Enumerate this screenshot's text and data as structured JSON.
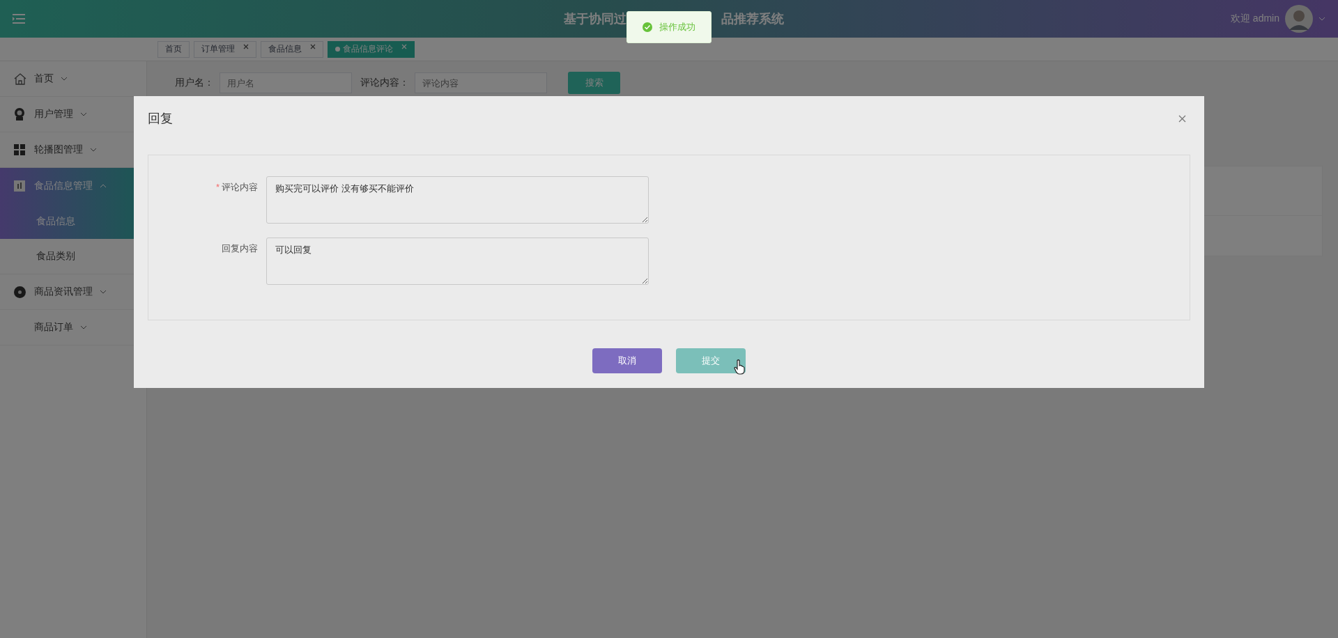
{
  "header": {
    "title_parts": [
      "基于协同过",
      "品推荐系统"
    ],
    "welcome": "欢迎 admin"
  },
  "toast": {
    "kind": "success",
    "message": "操作成功"
  },
  "tabs": [
    {
      "label": "首页",
      "selected": false,
      "closable": false
    },
    {
      "label": "订单管理",
      "selected": false,
      "closable": true
    },
    {
      "label": "食品信息",
      "selected": false,
      "closable": true
    },
    {
      "label": "食品信息评论",
      "selected": true,
      "closable": true
    }
  ],
  "sidebar": {
    "items": [
      {
        "label": "首页",
        "expanded": false
      },
      {
        "label": "用户管理",
        "expanded": false
      },
      {
        "label": "轮播图管理",
        "expanded": false
      },
      {
        "label": "食品信息管理",
        "expanded": true,
        "children": [
          {
            "label": "食品信息",
            "selected": true
          },
          {
            "label": "食品类别",
            "selected": false
          }
        ]
      },
      {
        "label": "商品资讯管理",
        "expanded": false
      },
      {
        "label": "商品订单",
        "expanded": false
      }
    ]
  },
  "search": {
    "fields": [
      {
        "label": "用户名：",
        "placeholder": "用户名"
      },
      {
        "label": "评论内容：",
        "placeholder": "评论内容"
      }
    ],
    "button": "搜索"
  },
  "dialog": {
    "title": "回复",
    "fields": [
      {
        "label": "评论内容",
        "required_mark": "*",
        "value": "购买完可以评价 没有够买不能评价"
      },
      {
        "label": "回复内容",
        "value": "可以回复"
      }
    ],
    "buttons": [
      {
        "label": "取消",
        "kind": "cancel"
      },
      {
        "label": "提交",
        "kind": "submit"
      }
    ]
  }
}
